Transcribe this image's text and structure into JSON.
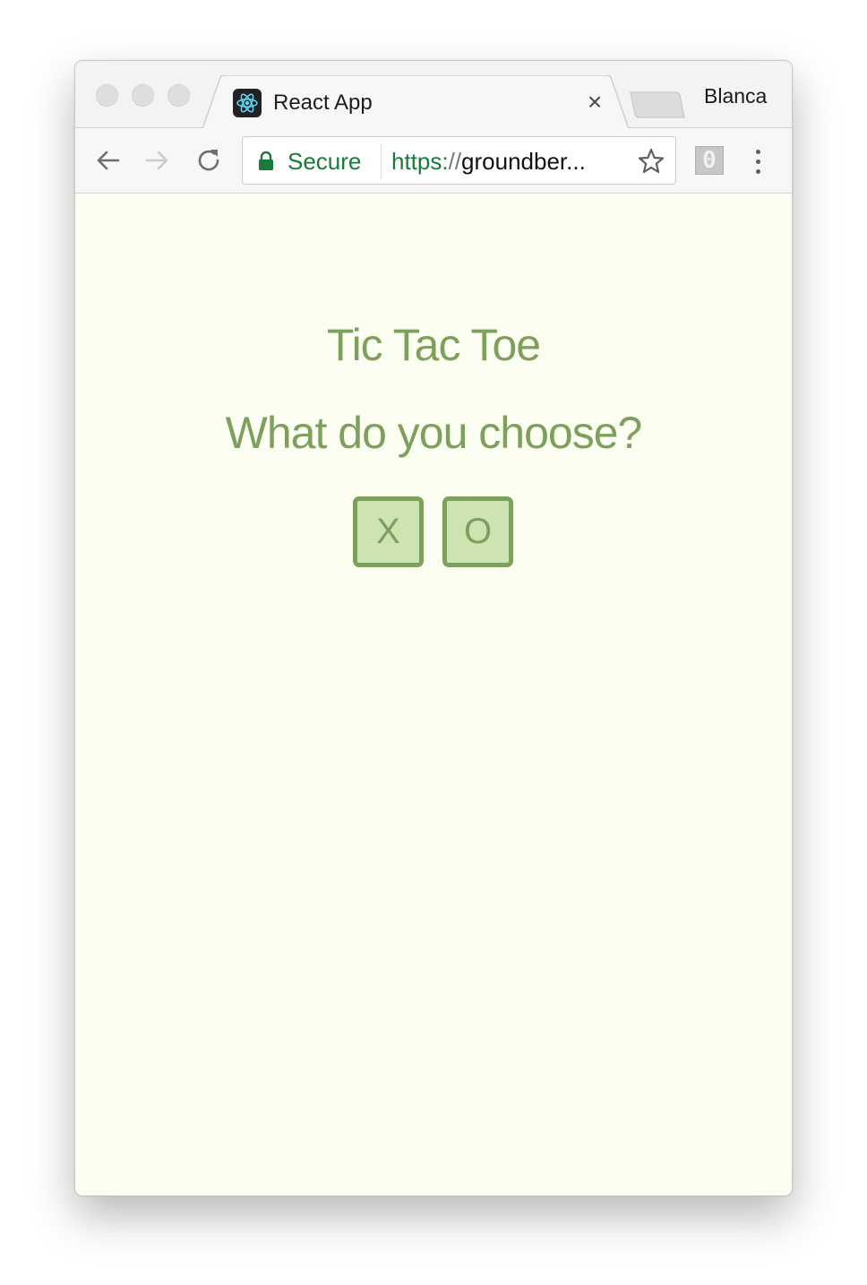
{
  "browser": {
    "tab": {
      "title": "React App",
      "close_symbol": "×",
      "favicon": "react-icon"
    },
    "profile_name": "Blanca",
    "toolbar": {
      "back_icon": "arrow-left-icon",
      "forward_icon": "arrow-right-icon",
      "reload_icon": "reload-icon",
      "security_label": "Secure",
      "url_scheme": "https:",
      "url_separator": "//",
      "url_host": "groundber...",
      "bookmark_icon": "star-icon",
      "extension_badge": "0",
      "menu_icon": "kebab-menu-icon"
    }
  },
  "page": {
    "title": "Tic Tac Toe",
    "prompt": "What do you choose?",
    "choices": [
      {
        "label": "X"
      },
      {
        "label": "O"
      }
    ]
  },
  "colors": {
    "page_background": "#fcfef2",
    "accent_green": "#7ea05d",
    "choice_fill": "#cde4b2",
    "secure_green": "#1a7a3a"
  }
}
